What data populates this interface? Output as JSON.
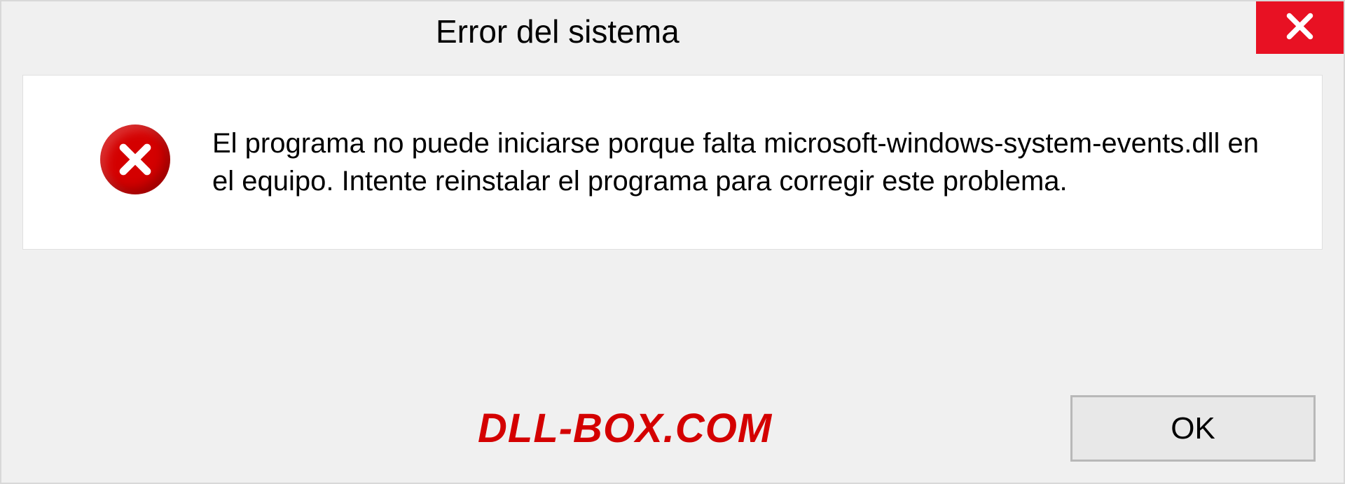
{
  "dialog": {
    "title": "Error del sistema",
    "message": "El programa no puede iniciarse porque falta microsoft-windows-system-events.dll en el equipo. Intente reinstalar el programa para corregir este problema.",
    "ok_label": "OK"
  },
  "watermark": "DLL-BOX.COM",
  "colors": {
    "close_bg": "#e81123",
    "error_icon": "#d40000",
    "watermark": "#d40000"
  }
}
